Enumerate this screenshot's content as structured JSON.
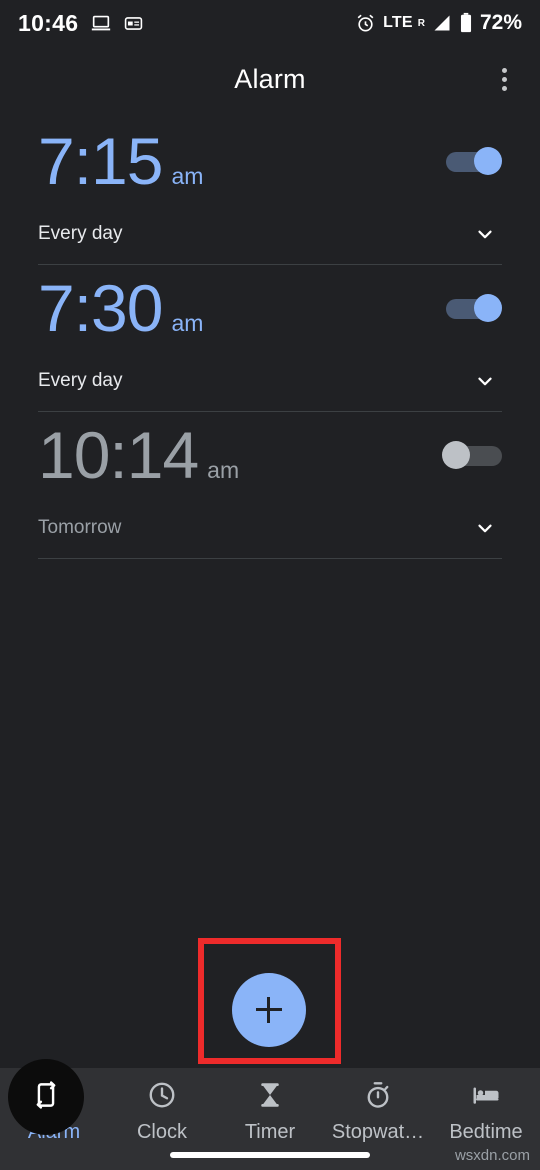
{
  "status_bar": {
    "clock": "10:46",
    "left_icons": [
      "laptop-icon",
      "news-card-icon"
    ],
    "network_label": "LTE",
    "roaming_label": "R",
    "battery_label": "72%",
    "right_icons": [
      "alarm-icon",
      "signal-icon",
      "battery-icon"
    ]
  },
  "app_bar": {
    "title": "Alarm",
    "overflow_label": "More options"
  },
  "alarms": [
    {
      "time": "7:15",
      "meridiem": "am",
      "schedule": "Every day",
      "enabled": true
    },
    {
      "time": "7:30",
      "meridiem": "am",
      "schedule": "Every day",
      "enabled": true
    },
    {
      "time": "10:14",
      "meridiem": "am",
      "schedule": "Tomorrow",
      "enabled": false
    }
  ],
  "fab": {
    "label": "+",
    "icon": "plus-icon",
    "highlight_color": "#ee2b2b"
  },
  "bottom_nav": {
    "items": [
      {
        "label": "Alarm",
        "icon": "alarm-clock-icon",
        "active": true
      },
      {
        "label": "Clock",
        "icon": "clock-icon",
        "active": false
      },
      {
        "label": "Timer",
        "icon": "hourglass-icon",
        "active": false
      },
      {
        "label": "Stopwat…",
        "icon": "stopwatch-icon",
        "active": false
      },
      {
        "label": "Bedtime",
        "icon": "bed-icon",
        "active": false
      }
    ]
  },
  "overlay": {
    "rotate_button_icon": "screen-rotate-icon"
  },
  "watermark": "wsxdn.com",
  "colors": {
    "background": "#202124",
    "accent_blue": "#8ab4f8",
    "nav_background": "#303134",
    "disabled_gray": "#9aa0a6",
    "highlight_red": "#ee2b2b"
  }
}
